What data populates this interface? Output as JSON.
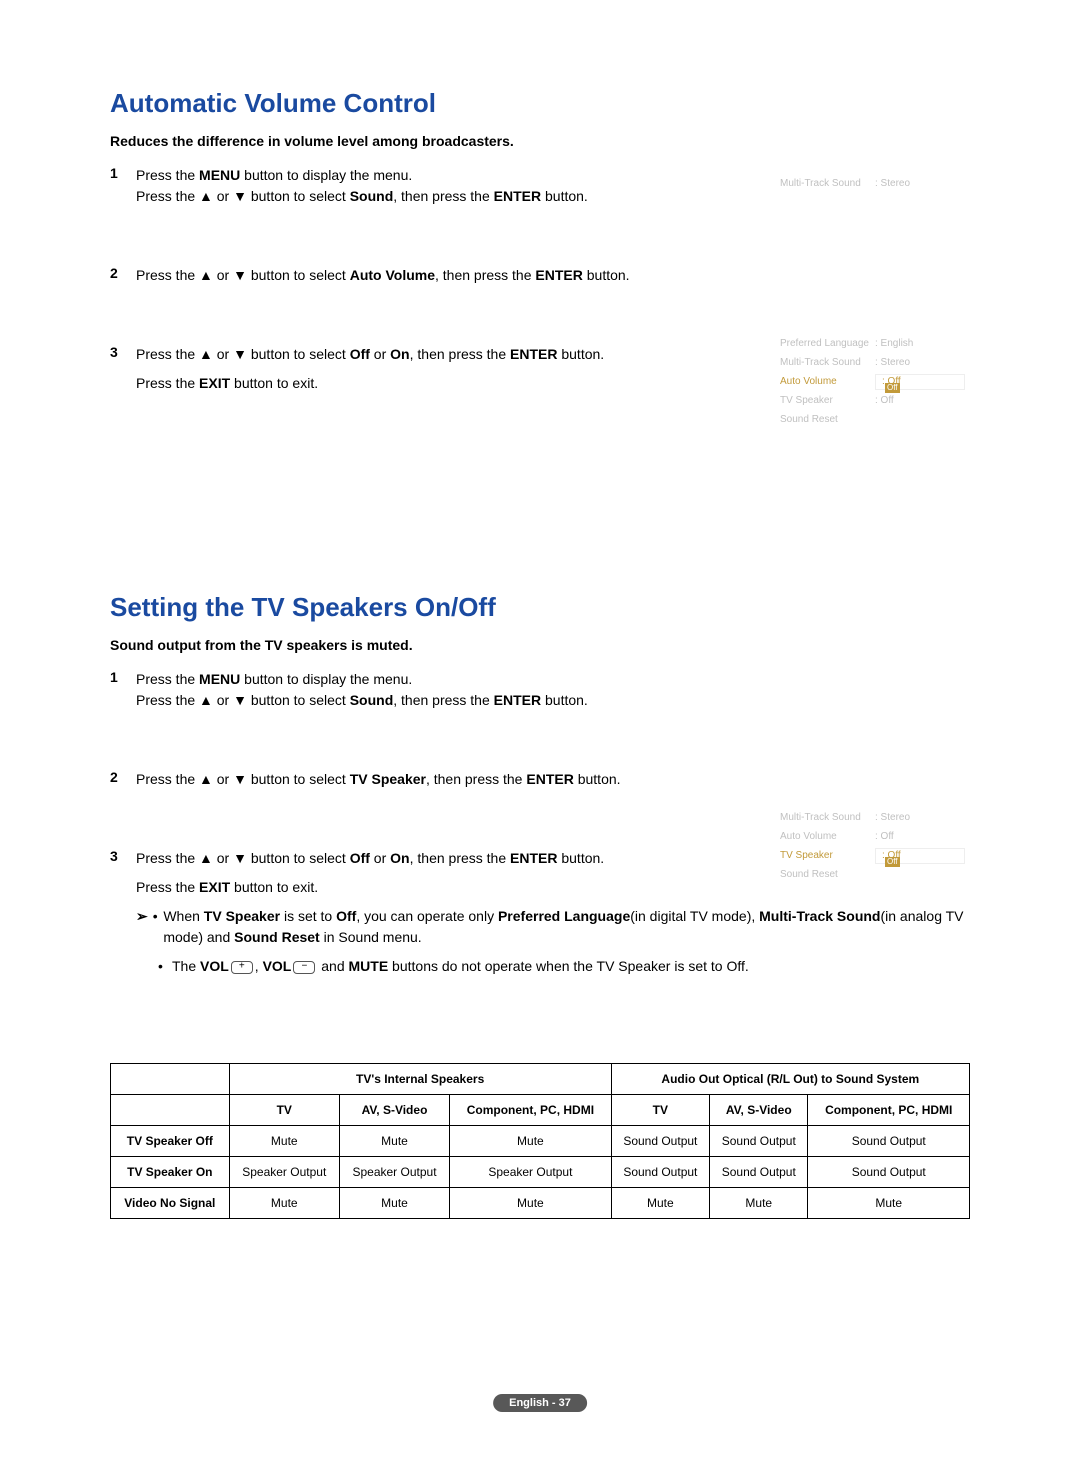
{
  "section1": {
    "title": "Automatic Volume Control",
    "subtitle": "Reduces the difference in volume level among broadcasters.",
    "steps": [
      {
        "n": "1",
        "t_pre": "Press the ",
        "b1": "MENU",
        "t_mid": " button to display the menu.",
        "line2_pre": "Press the ▲ or ▼ button to select ",
        "b2": "Sound",
        "line2_mid": ", then press the ",
        "b3": "ENTER",
        "line2_post": " button."
      },
      {
        "n": "2",
        "t_pre": "Press the ▲ or ▼ button to select ",
        "b1": "Auto Volume",
        "t_mid": ", then press the ",
        "b2": "ENTER",
        "t_post": " button."
      },
      {
        "n": "3",
        "t_pre": "Press the ▲ or ▼ button to select ",
        "b1": "Off",
        "t_mid": " or ",
        "b2": "On",
        "t_mid2": ", then press the ",
        "b3": "ENTER",
        "t_post": " button.",
        "exit_pre": "Press the ",
        "b4": "EXIT",
        "exit_post": " button to exit."
      }
    ],
    "osd_a": {
      "label": "Multi-Track Sound",
      "value": ": Stereo"
    },
    "osd_b": [
      {
        "label": "Preferred Language",
        "value": ": English"
      },
      {
        "label": "Multi-Track Sound",
        "value": ": Stereo"
      },
      {
        "label": "Auto Volume",
        "value": ": Off",
        "hi": true,
        "sel": "Off"
      },
      {
        "label": "TV  Speaker",
        "value": ": Off"
      },
      {
        "label": "Sound Reset",
        "value": ""
      }
    ]
  },
  "section2": {
    "title": "Setting the TV Speakers On/Off",
    "subtitle": "Sound output from the TV speakers is muted.",
    "steps": [
      {
        "n": "1",
        "t_pre": "Press the ",
        "b1": "MENU",
        "t_mid": " button to display the menu.",
        "line2_pre": "Press the ▲ or ▼ button to select ",
        "b2": "Sound",
        "line2_mid": ", then press the ",
        "b3": "ENTER",
        "line2_post": " button."
      },
      {
        "n": "2",
        "t_pre": "Press the ▲ or ▼ button to select ",
        "b1": "TV Speaker",
        "t_mid": ", then press the ",
        "b2": "ENTER",
        "t_post": " button."
      },
      {
        "n": "3",
        "t_pre": "Press the ▲ or ▼ button to select ",
        "b1": "Off",
        "t_mid": " or ",
        "b2": "On",
        "t_mid2": ", then press the ",
        "b3": "ENTER",
        "t_post": " button.",
        "exit_pre": "Press the ",
        "b4": "EXIT",
        "exit_post": " button to exit."
      }
    ],
    "note1_pre": "When ",
    "note1_b1": "TV Speaker",
    "note1_mid": " is set to ",
    "note1_b2": "Off",
    "note1_mid2": ", you can operate only ",
    "note1_b3": "Preferred Language",
    "note1_mid3": "(in digital TV mode), ",
    "note1_b4": "Multi-Track Sound",
    "note1_mid4": "(in analog TV mode) and ",
    "note1_b5": "Sound Reset",
    "note1_post": " in Sound menu.",
    "note2_pre": "The ",
    "note2_b1": "VOL",
    "note2_mid": ", ",
    "note2_b2": "VOL",
    "note2_mid2": " and ",
    "note2_b3": "MUTE",
    "note2_post": " buttons do not operate when the TV Speaker is set to Off.",
    "osd": [
      {
        "label": "Multi-Track Sound",
        "value": ": Stereo"
      },
      {
        "label": "Auto Volume",
        "value": ": Off"
      },
      {
        "label": "TV Speaker",
        "value": ": Off",
        "hi": true,
        "sel": "Off"
      },
      {
        "label": "Sound Reset",
        "value": ""
      }
    ]
  },
  "table": {
    "group1": "TV's Internal Speakers",
    "group2": "Audio Out Optical (R/L Out) to Sound System",
    "cols": [
      "TV",
      "AV, S-Video",
      "Component, PC, HDMI",
      "TV",
      "AV, S-Video",
      "Component, PC, HDMI"
    ],
    "rows": [
      {
        "h": "TV Speaker Off",
        "c": [
          "Mute",
          "Mute",
          "Mute",
          "Sound Output",
          "Sound Output",
          "Sound Output"
        ]
      },
      {
        "h": "TV Speaker On",
        "c": [
          "Speaker Output",
          "Speaker Output",
          "Speaker Output",
          "Sound Output",
          "Sound Output",
          "Sound Output"
        ]
      },
      {
        "h": "Video No Signal",
        "c": [
          "Mute",
          "Mute",
          "Mute",
          "Mute",
          "Mute",
          "Mute"
        ]
      }
    ]
  },
  "footer": "English - 37"
}
